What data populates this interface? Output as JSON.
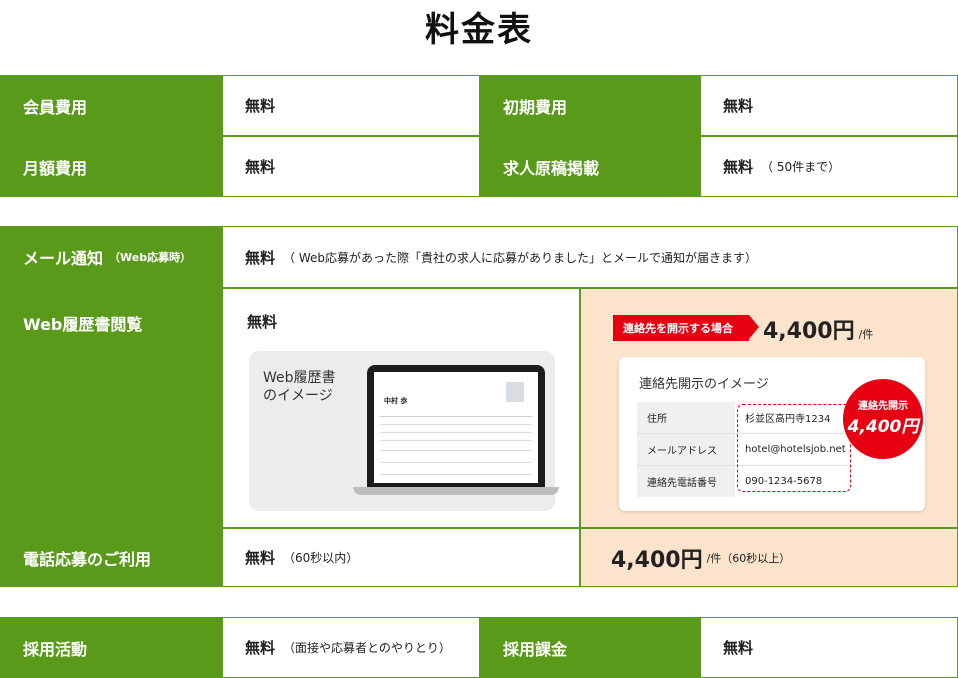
{
  "page_title": "料金表",
  "table1": {
    "rows": [
      {
        "label1": "会員費用",
        "value1": "無料",
        "label2": "初期費用",
        "value2": "無料",
        "note2": ""
      },
      {
        "label1": "月額費用",
        "value1": "無料",
        "label2": "求人原稿掲載",
        "value2": "無料",
        "note2": "（ 50件まで）"
      }
    ]
  },
  "mail": {
    "label": "メール通知",
    "label_note": "（Web応募時）",
    "value": "無料",
    "note": "（ Web応募があった際「貴社の求人に応募がありました」とメールで通知が届きます）"
  },
  "web": {
    "label": "Web履歴書閲覧",
    "free_value": "無料",
    "image_caption_line1": "Web履歴書",
    "image_caption_line2": "のイメージ",
    "resume_name": "中村 歩",
    "badge": "連絡先を開示する場合",
    "price": "4,400円",
    "price_unit": "/件",
    "card_title": "連絡先開示のイメージ",
    "card_rows": [
      {
        "key": "住所",
        "val": "杉並区高円寺1234"
      },
      {
        "key": "メールアドレス",
        "val": "hotel@hotelsjob.net"
      },
      {
        "key": "連絡先電話番号",
        "val": "090-1234-5678"
      }
    ],
    "bubble_line1": "連絡先開示",
    "bubble_line2": "4,400円"
  },
  "phone": {
    "label": "電話応募のご利用",
    "value": "無料",
    "note": "（60秒以内）",
    "price": "4,400円",
    "price_note": "/件（60秒以上）"
  },
  "table3": {
    "label1": "採用活動",
    "value1": "無料",
    "note1": "（面接や応募者とのやりとり）",
    "label2": "採用課金",
    "value2": "無料"
  },
  "colors": {
    "green": "#5a9a1a",
    "red": "#e60012",
    "peach": "#fbe3cc"
  }
}
